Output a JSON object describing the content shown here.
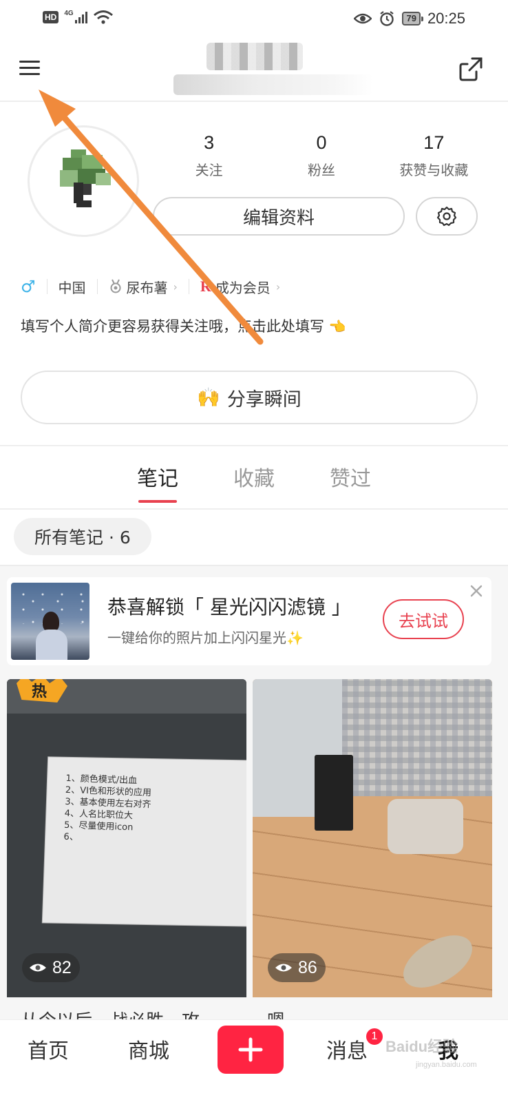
{
  "status_bar": {
    "hd": "HD",
    "network": "4G",
    "battery": "79",
    "time": "20:25"
  },
  "profile": {
    "stats": [
      {
        "value": "3",
        "label": "关注"
      },
      {
        "value": "0",
        "label": "粉丝"
      },
      {
        "value": "17",
        "label": "获赞与收藏"
      }
    ],
    "edit_label": "编辑资料",
    "gender_symbol": "♂",
    "region": "中国",
    "level": "尿布薯",
    "member": "成为会员",
    "member_icon": "R",
    "bio_prompt": "填写个人简介更容易获得关注哦，点击此处填写",
    "bio_emoji": "👈",
    "share_moment": "分享瞬间",
    "share_emoji": "🙌"
  },
  "tabs": [
    {
      "label": "笔记",
      "active": true
    },
    {
      "label": "收藏",
      "active": false
    },
    {
      "label": "赞过",
      "active": false
    }
  ],
  "filter": {
    "label": "所有笔记 · 6"
  },
  "promo": {
    "title": "恭喜解锁「 星光闪闪滤镜 」",
    "subtitle": "一键给你的照片加上闪闪星光✨",
    "button": "去试试"
  },
  "notes": [
    {
      "views": "82",
      "title_peek": "从今以后，战必胜，攻"
    },
    {
      "views": "86",
      "title_peek": "嗯"
    }
  ],
  "screen_list": [
    "1、颜色模式/出血",
    "2、VI色和形状的应用",
    "3、基本使用左右对齐",
    "4、人名比职位大",
    "5、尽量使用icon",
    "6、"
  ],
  "hot_label": "热",
  "bottom_nav": {
    "home": "首页",
    "shop": "商城",
    "messages": "消息",
    "messages_badge": "1",
    "me": "我"
  },
  "watermark": {
    "brand": "Baidu经验",
    "url": "jingyan.baidu.com"
  },
  "colors": {
    "accent": "#e8414f",
    "publish": "#ff2442",
    "annotation_arrow": "#f08a3c"
  }
}
